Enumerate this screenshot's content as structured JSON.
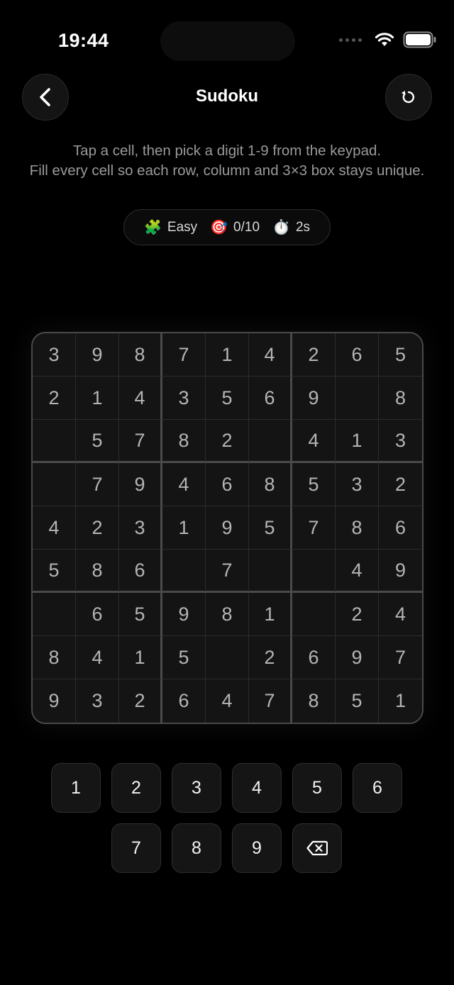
{
  "status_bar": {
    "time": "19:44"
  },
  "header": {
    "title": "Sudoku",
    "back_icon": "chevron-left-icon",
    "reset_icon": "refresh-icon"
  },
  "instructions": {
    "line1": "Tap a cell, then pick a digit 1-9 from the keypad.",
    "line2": "Fill every cell so each row, column and 3×3 box stays unique."
  },
  "stats": {
    "difficulty": "Easy",
    "difficulty_icon": "🧩",
    "progress": "0/10",
    "progress_icon": "🎯",
    "timer": "2s",
    "timer_icon": "⏱️"
  },
  "board": [
    [
      "3",
      "9",
      "8",
      "7",
      "1",
      "4",
      "2",
      "6",
      "5"
    ],
    [
      "2",
      "1",
      "4",
      "3",
      "5",
      "6",
      "9",
      "",
      "8"
    ],
    [
      "",
      "5",
      "7",
      "8",
      "2",
      "",
      "4",
      "1",
      "3"
    ],
    [
      "",
      "7",
      "9",
      "4",
      "6",
      "8",
      "5",
      "3",
      "2"
    ],
    [
      "4",
      "2",
      "3",
      "1",
      "9",
      "5",
      "7",
      "8",
      "6"
    ],
    [
      "5",
      "8",
      "6",
      "",
      "7",
      "",
      "",
      "4",
      "9"
    ],
    [
      "",
      "6",
      "5",
      "9",
      "8",
      "1",
      "",
      "2",
      "4"
    ],
    [
      "8",
      "4",
      "1",
      "5",
      "",
      "2",
      "6",
      "9",
      "7"
    ],
    [
      "9",
      "3",
      "2",
      "6",
      "4",
      "7",
      "8",
      "5",
      "1"
    ]
  ],
  "keypad": {
    "keys": [
      "1",
      "2",
      "3",
      "4",
      "5",
      "6",
      "7",
      "8",
      "9"
    ],
    "delete_icon": "backspace-icon"
  },
  "colors": {
    "background": "#000000",
    "cell_text": "#b5b5b5",
    "border": "#4a4a4a"
  }
}
